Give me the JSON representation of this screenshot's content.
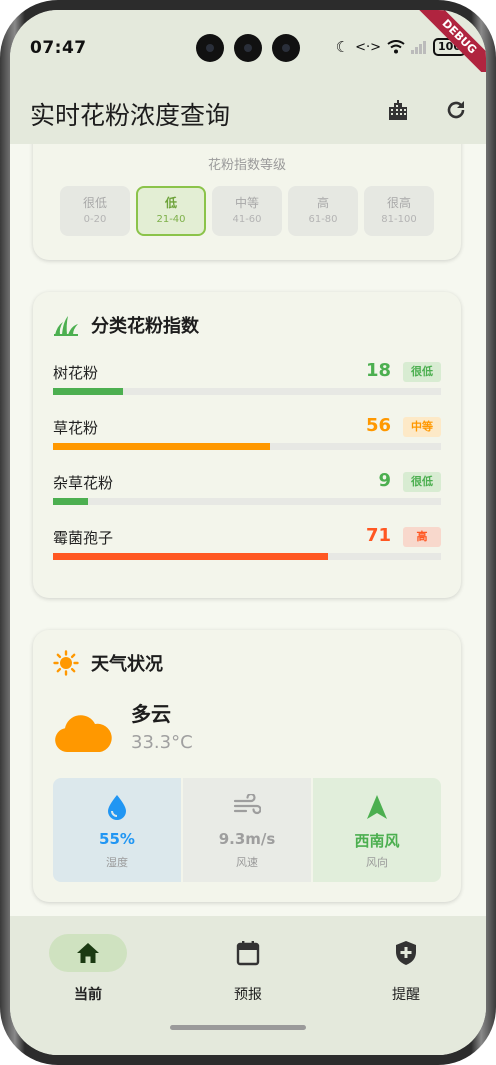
{
  "status_bar": {
    "time": "07:47",
    "battery": "100",
    "icons": [
      "moon-icon",
      "data-transfer-icon",
      "wifi-icon",
      "signal-icon",
      "battery-icon"
    ]
  },
  "debug_banner": "DEBUG",
  "app_bar": {
    "title": "实时花粉浓度查询",
    "actions": [
      "city-icon",
      "refresh-icon"
    ]
  },
  "level_scale": {
    "title": "花粉指数等级",
    "levels": [
      {
        "name": "很低",
        "range": "0-20"
      },
      {
        "name": "低",
        "range": "21-40",
        "active": true
      },
      {
        "name": "中等",
        "range": "41-60"
      },
      {
        "name": "高",
        "range": "61-80"
      },
      {
        "name": "很高",
        "range": "81-100"
      }
    ]
  },
  "categories": {
    "title": "分类花粉指数",
    "max": 100,
    "items": [
      {
        "name": "树花粉",
        "value": "18",
        "level": "很低",
        "percent": 18,
        "color": "#4caf50",
        "badge_bg": "#d8ecd2"
      },
      {
        "name": "草花粉",
        "value": "56",
        "level": "中等",
        "percent": 56,
        "color": "#ff9800",
        "badge_bg": "#fde9c7"
      },
      {
        "name": "杂草花粉",
        "value": "9",
        "level": "很低",
        "percent": 9,
        "color": "#4caf50",
        "badge_bg": "#d8ecd2"
      },
      {
        "name": "霉菌孢子",
        "value": "71",
        "level": "高",
        "percent": 71,
        "color": "#ff5722",
        "badge_bg": "#f8d8cc"
      }
    ]
  },
  "weather": {
    "title": "天气状况",
    "condition": "多云",
    "temperature": "33.3°C",
    "stats": [
      {
        "value": "55%",
        "label": "湿度",
        "icon": "water-drop-icon",
        "color": "#2196f3"
      },
      {
        "value": "9.3m/s",
        "label": "风速",
        "icon": "wind-icon",
        "color": "#9e9e9e"
      },
      {
        "value": "西南风",
        "label": "风向",
        "icon": "navigation-arrow-icon",
        "color": "#4caf50"
      }
    ]
  },
  "bottom_nav": {
    "items": [
      {
        "label": "当前",
        "icon": "home-icon",
        "active": true
      },
      {
        "label": "预报",
        "icon": "calendar-icon"
      },
      {
        "label": "提醒",
        "icon": "shield-plus-icon"
      }
    ]
  }
}
